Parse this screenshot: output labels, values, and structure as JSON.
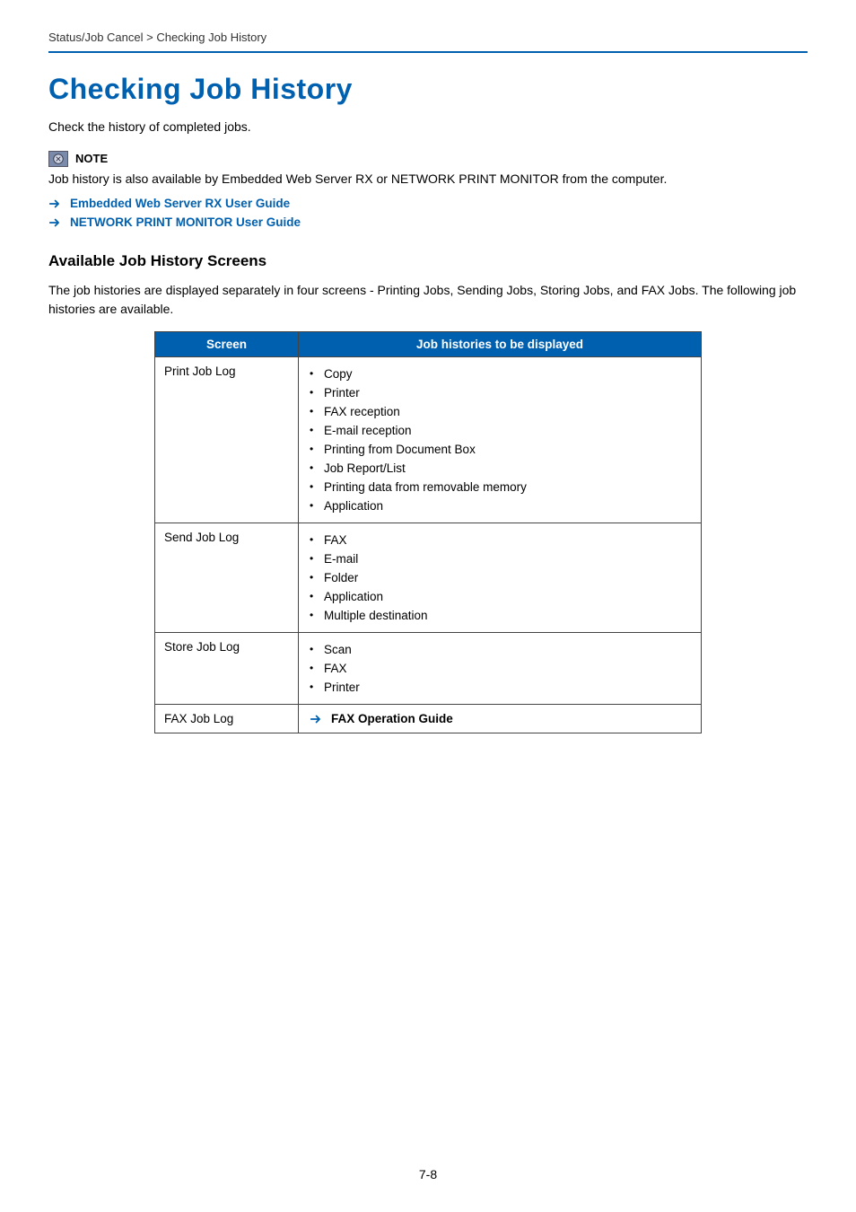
{
  "breadcrumb": "Status/Job Cancel > Checking Job History",
  "heading": "Checking Job History",
  "intro": "Check the history of completed jobs.",
  "note": {
    "label": "NOTE",
    "text": "Job history is also available by Embedded Web Server RX or NETWORK PRINT MONITOR from the computer."
  },
  "links": [
    "Embedded Web Server RX User Guide",
    "NETWORK PRINT MONITOR User Guide"
  ],
  "section_heading": "Available Job History Screens",
  "section_para": "The job histories are displayed separately in four screens - Printing Jobs, Sending Jobs, Storing Jobs, and FAX Jobs. The following job histories are available.",
  "table": {
    "headers": {
      "col1": "Screen",
      "col2": "Job histories to be displayed"
    },
    "rows": [
      {
        "screen": "Print Job Log",
        "type": "bullets",
        "items": [
          "Copy",
          "Printer",
          "FAX reception",
          "E-mail reception",
          "Printing from Document Box",
          "Job Report/List",
          "Printing data from removable memory",
          "Application"
        ]
      },
      {
        "screen": "Send Job Log",
        "type": "bullets",
        "items": [
          "FAX",
          "E-mail",
          "Folder",
          "Application",
          "Multiple destination"
        ]
      },
      {
        "screen": "Store Job Log",
        "type": "bullets",
        "items": [
          "Scan",
          "FAX",
          "Printer"
        ]
      },
      {
        "screen": "FAX Job Log",
        "type": "link",
        "link_text": "FAX Operation Guide"
      }
    ]
  },
  "page_number": "7-8"
}
